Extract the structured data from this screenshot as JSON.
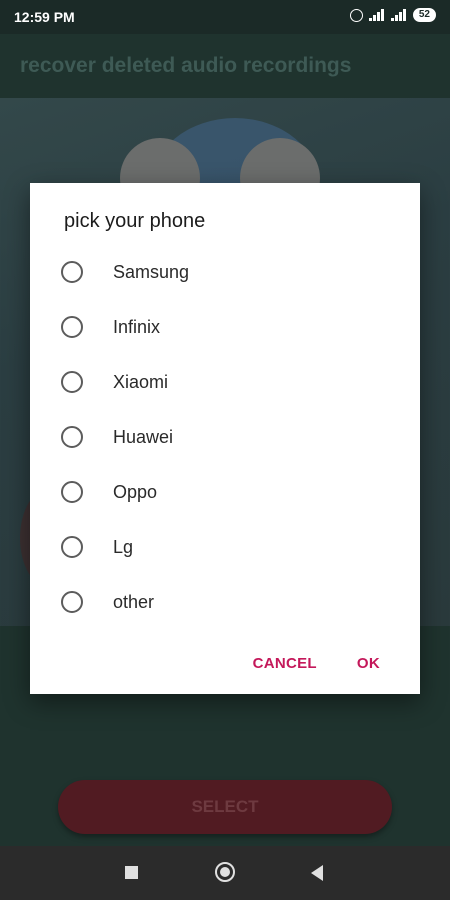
{
  "status_bar": {
    "time": "12:59 PM",
    "battery": "52",
    "icons": [
      "alarm-icon",
      "signal-icon",
      "signal-icon",
      "battery-icon"
    ]
  },
  "app_bar": {
    "title": "recover deleted audio recordings"
  },
  "dialog": {
    "title": "pick your phone",
    "options": [
      {
        "label": "Samsung",
        "selected": false
      },
      {
        "label": "Infinix",
        "selected": false
      },
      {
        "label": "Xiaomi",
        "selected": false
      },
      {
        "label": "Huawei",
        "selected": false
      },
      {
        "label": "Oppo",
        "selected": false
      },
      {
        "label": "Lg",
        "selected": false
      },
      {
        "label": "other",
        "selected": false
      }
    ],
    "cancel_label": "CANCEL",
    "ok_label": "OK",
    "accent_color": "#C4185A"
  },
  "main": {
    "select_label": "SELECT"
  },
  "nav_bar": {
    "icons": [
      "recents-square-icon",
      "home-circle-icon",
      "back-triangle-icon"
    ]
  }
}
